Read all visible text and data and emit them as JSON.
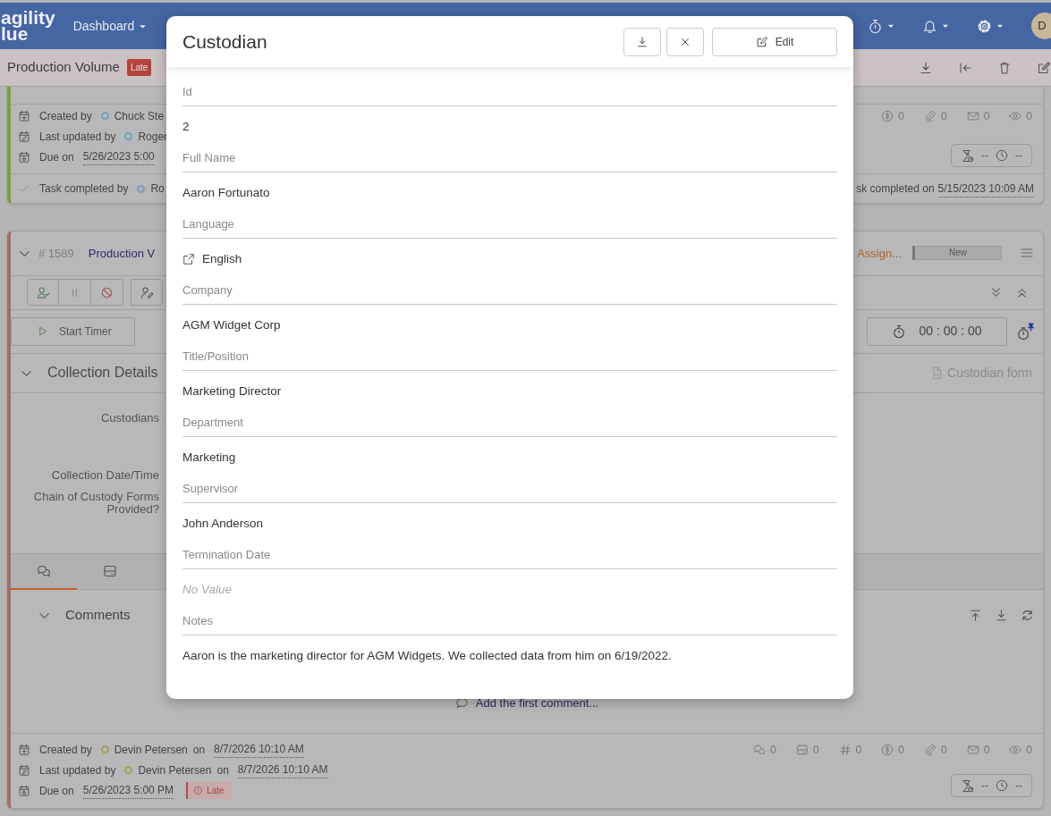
{
  "navbar": {
    "logo": [
      "agility",
      "lue"
    ],
    "menu": "Dashboard",
    "avatar": "D"
  },
  "subheader": {
    "title": "Production Volume",
    "badge": "Late"
  },
  "completed_card": {
    "audit": [
      {
        "kind": "created",
        "label": "Created by",
        "person": "Chuck Ste",
        "color": "#6fa3b8"
      },
      {
        "kind": "updated",
        "label": "Last updated by",
        "person": "Roger",
        "color": "#6fa3b8"
      },
      {
        "kind": "due",
        "label": "Due on",
        "date": "5/26/2023 5:00"
      }
    ],
    "counters": [
      {
        "kind": "dollar",
        "value": "0"
      },
      {
        "kind": "attachment",
        "value": "0"
      },
      {
        "kind": "mail",
        "value": "0"
      },
      {
        "kind": "views",
        "value": "0"
      }
    ],
    "time": {
      "estimate": "--",
      "spent": "--"
    },
    "completed_by": {
      "label": "Task completed by",
      "person": "Ro",
      "color": "#6fa3b8"
    },
    "completed_on": {
      "label": "sk completed on",
      "date": "5/15/2023 10:09 AM"
    }
  },
  "task": {
    "number": "# 1589",
    "title": "Production V",
    "assignee": "Assign...",
    "status": "New",
    "timer_button": "Start Timer",
    "timer": "00 : 00 : 00",
    "section": "Collection Details",
    "form_link": "Custodian form",
    "fields": [
      "Custodians",
      "Collection Date/Time",
      "Chain of Custody Forms Provided?"
    ],
    "tabs": [
      {
        "kind": "comments",
        "selected": true
      },
      {
        "kind": "cards",
        "selected": false
      }
    ],
    "comments": {
      "title": "Comments",
      "add": "Add the first comment..."
    },
    "audit": [
      {
        "kind": "created",
        "label": "Created by",
        "person": "Devin Petersen",
        "color": "#a5a05a",
        "on": "on",
        "date": "8/7/2026 10:10 AM"
      },
      {
        "kind": "updated",
        "label": "Last updated by",
        "person": "Devin Petersen",
        "color": "#a5a05a",
        "on": "on",
        "date": "8/7/2026 10:10 AM"
      },
      {
        "kind": "due",
        "label": "Due on",
        "date": "5/26/2023 5:00 PM",
        "badge": "Late"
      }
    ],
    "counters": [
      {
        "kind": "comments",
        "value": "0"
      },
      {
        "kind": "cards",
        "value": "0"
      },
      {
        "kind": "hash",
        "value": "0"
      },
      {
        "kind": "dollar",
        "value": "0"
      },
      {
        "kind": "attachment",
        "value": "0"
      },
      {
        "kind": "mail",
        "value": "0"
      },
      {
        "kind": "views",
        "value": "0"
      }
    ],
    "time": {
      "estimate": "--",
      "spent": "--"
    }
  },
  "dialog": {
    "title": "Custodian",
    "edit": "Edit",
    "fields": [
      {
        "label": "Id",
        "value": "2"
      },
      {
        "label": "Full Name",
        "value": "Aaron Fortunato"
      },
      {
        "label": "Language",
        "value": "English",
        "kind": "link"
      },
      {
        "label": "Company",
        "value": "AGM Widget Corp"
      },
      {
        "label": "Title/Position",
        "value": "Marketing Director"
      },
      {
        "label": "Department",
        "value": "Marketing"
      },
      {
        "label": "Supervisor",
        "value": "John Anderson"
      },
      {
        "label": "Termination Date",
        "value": "No Value",
        "empty": true
      },
      {
        "label": "Notes",
        "value": "Aaron is the marketing director for AGM Widgets. We collected data from him on 6/19/2022."
      }
    ]
  }
}
